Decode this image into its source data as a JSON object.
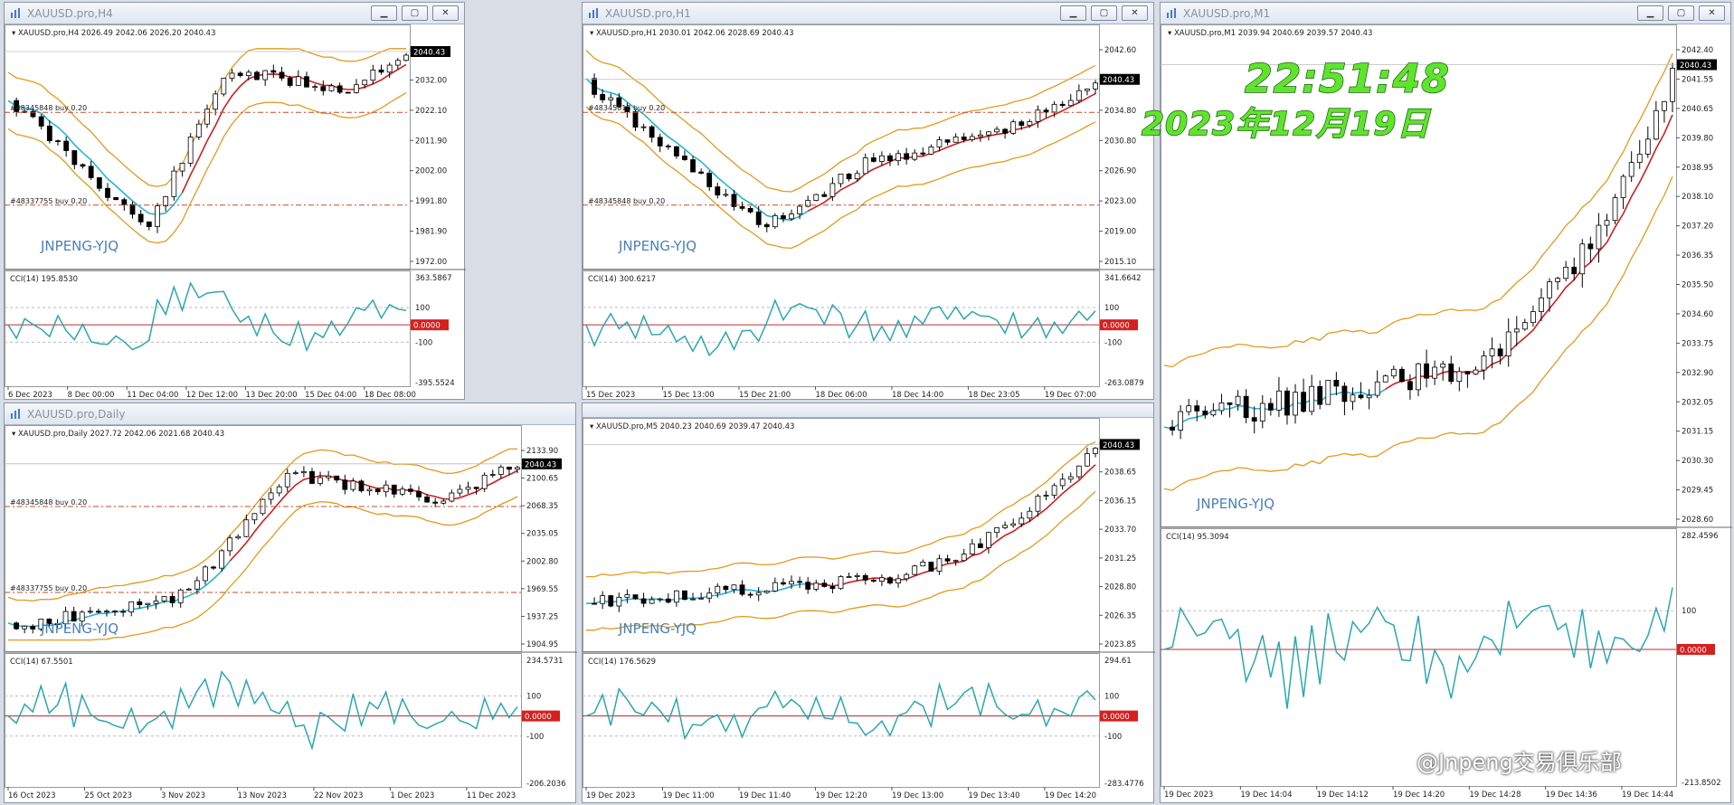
{
  "windows": [
    {
      "id": "h4",
      "title": "XAUUSD.pro,H4",
      "header": "XAUUSD.pro,H4  2026.49 2042.06 2026.20 2040.43",
      "price_labels": [
        "2042.30",
        "2032.00",
        "2022.10",
        "2011.90",
        "2002.00",
        "1991.80",
        "1981.90",
        "1972.00"
      ],
      "current_price": "2040.43",
      "order_labels": [
        "#48345848 buy 0.20",
        "#48337755 buy 0.20"
      ],
      "indicator": {
        "header": "CCI(14) 195.8530",
        "labels": [
          "363.5867",
          "100",
          "-100",
          "-395.5524"
        ],
        "zero_label": "0.0000"
      },
      "time_labels": [
        "6 Dec 2023",
        "8 Dec 00:00",
        "11 Dec 04:00",
        "12 Dec 12:00",
        "13 Dec 20:00",
        "15 Dec 04:00",
        "18 Dec 08:00"
      ],
      "watermark": "JNPENG-YJQ"
    },
    {
      "id": "h1",
      "title": "XAUUSD.pro,H1",
      "header": "XAUUSD.pro,H1  2030.01 2042.06 2028.69 2040.43",
      "price_labels": [
        "2042.60",
        "2038.70",
        "2034.80",
        "2030.80",
        "2026.90",
        "2023.00",
        "2019.00",
        "2015.10"
      ],
      "current_price": "2040.43",
      "order_labels": [
        "#48345818 buy 0.20",
        "#48345848 buy 0.20"
      ],
      "indicator": {
        "header": "CCI(14) 300.6217",
        "labels": [
          "341.6642",
          "100",
          "-100",
          "-263.0879"
        ],
        "zero_label": "0.0000"
      },
      "time_labels": [
        "15 Dec 2023",
        "15 Dec 13:00",
        "15 Dec 21:00",
        "18 Dec 06:00",
        "18 Dec 14:00",
        "18 Dec 23:05",
        "19 Dec 07:00"
      ],
      "watermark": "JNPENG-YJQ"
    },
    {
      "id": "m1",
      "title": "XAUUSD.pro,M1",
      "header": "XAUUSD.pro,M1  2039.94 2040.69 2039.57 2040.43",
      "price_labels": [
        "2042.40",
        "2041.55",
        "2040.65",
        "2039.80",
        "2038.95",
        "2038.10",
        "2037.20",
        "2036.35",
        "2035.50",
        "2034.60",
        "2033.75",
        "2032.90",
        "2032.05",
        "2031.15",
        "2030.30",
        "2029.45",
        "2028.60"
      ],
      "current_price": "2040.43",
      "order_labels": [],
      "indicator": {
        "header": "CCI(14) 95.3094",
        "labels": [
          "282.4596",
          "100",
          "-213.8502"
        ],
        "zero_label": "0.0000"
      },
      "time_labels": [
        "19 Dec 2023",
        "19 Dec 14:04",
        "19 Dec 14:12",
        "19 Dec 14:20",
        "19 Dec 14:28",
        "19 Dec 14:36",
        "19 Dec 14:44"
      ],
      "watermark": "JNPENG-YJQ"
    },
    {
      "id": "d1",
      "title": "XAUUSD.pro,Daily",
      "header": "XAUUSD.pro,Daily  2027.72 2042.06 2021.68 2040.43",
      "price_labels": [
        "2133.90",
        "2100.65",
        "2068.35",
        "2035.05",
        "2002.80",
        "1969.55",
        "1937.25",
        "1904.95"
      ],
      "current_price": "2040.43",
      "order_labels": [
        "#48345848 buy 0.20",
        "#48337755 buy 0.20"
      ],
      "indicator": {
        "header": "CCI(14) 67.5501",
        "labels": [
          "234.5731",
          "100",
          "-100",
          "-206.2036"
        ],
        "zero_label": "0.0000"
      },
      "time_labels": [
        "16 Oct 2023",
        "25 Oct 2023",
        "3 Nov 2023",
        "13 Nov 2023",
        "22 Nov 2023",
        "1 Dec 2023",
        "11 Dec 2023"
      ],
      "watermark": "JNPENG-YJQ"
    },
    {
      "id": "m5",
      "title": "",
      "header": "XAUUSD.pro,M5  2040.23 2040.69 2039.47 2040.43",
      "price_labels": [
        "2041.10",
        "2038.65",
        "2036.15",
        "2033.70",
        "2031.25",
        "2028.80",
        "2026.35",
        "2023.85"
      ],
      "current_price": "2040.43",
      "order_labels": [],
      "indicator": {
        "header": "CCI(14) 176.5629",
        "labels": [
          "294.61",
          "100",
          "-100",
          "-283.4776"
        ],
        "zero_label": "0.0000"
      },
      "time_labels": [
        "19 Dec 2023",
        "19 Dec 11:00",
        "19 Dec 11:40",
        "19 Dec 12:20",
        "19 Dec 13:00",
        "19 Dec 13:40",
        "19 Dec 14:20"
      ],
      "watermark": "JNPENG-YJQ"
    }
  ],
  "overlay": {
    "time": "22:51:48",
    "date": "2023年12月19日",
    "watermark": "@Jnpeng交易俱乐部"
  },
  "colors": {
    "bollinger": "#e39a1a",
    "ma_red": "#cc1f1f",
    "ma_cyan": "#22b6d4",
    "cci": "#2aa7b1",
    "order_line": "#c9482b",
    "zero_line": "#c42b2b",
    "price_tag_bg": "#000000"
  }
}
